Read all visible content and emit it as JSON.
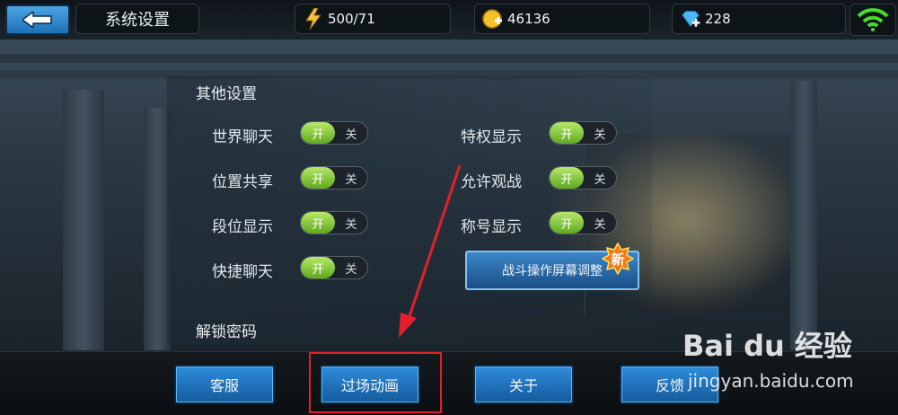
{
  "header": {
    "back_icon": "back-arrow-icon",
    "title": "系统设置",
    "resources": [
      {
        "name": "stamina",
        "icon": "lightning-icon",
        "value": "500/71"
      },
      {
        "name": "gold",
        "icon": "coin-plus-icon",
        "value": "46136"
      },
      {
        "name": "diamond",
        "icon": "diamond-plus-icon",
        "value": "228"
      }
    ],
    "wifi_icon": "wifi-icon",
    "wifi_color": "#4cd82e"
  },
  "settings": {
    "section_title": "其他设置",
    "toggles": [
      {
        "label": "世界聊天",
        "on": "开",
        "off": "关",
        "state": "on"
      },
      {
        "label": "位置共享",
        "on": "开",
        "off": "关",
        "state": "on"
      },
      {
        "label": "段位显示",
        "on": "开",
        "off": "关",
        "state": "on"
      },
      {
        "label": "快捷聊天",
        "on": "开",
        "off": "关",
        "state": "on"
      },
      {
        "label": "特权显示",
        "on": "开",
        "off": "关",
        "state": "on"
      },
      {
        "label": "允许观战",
        "on": "开",
        "off": "关",
        "state": "on"
      },
      {
        "label": "称号显示",
        "on": "开",
        "off": "关",
        "state": "on"
      }
    ],
    "adjust_button": "战斗操作屏幕调整",
    "new_badge": "新",
    "unlock_label": "解锁密码"
  },
  "footer": {
    "buttons": [
      "客服",
      "过场动画",
      "关于",
      "反馈"
    ]
  },
  "watermark": {
    "logo_text": "Bai du 经验",
    "url": "jingyan.baidu.com"
  },
  "colors": {
    "toggle_on": "#7cc93a",
    "button_blue": "#1f74c0",
    "highlight_red": "#e3202a"
  }
}
